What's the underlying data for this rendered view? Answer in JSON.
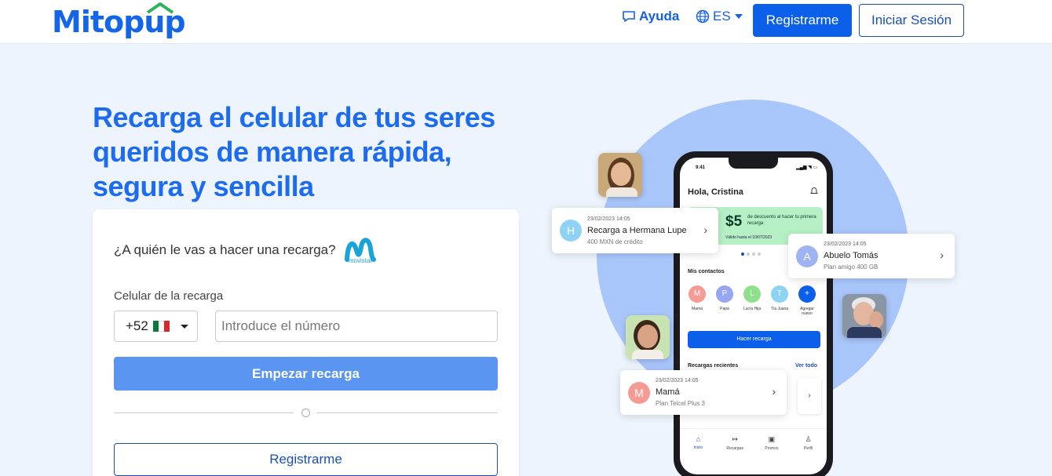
{
  "header": {
    "logo": "Mitopup",
    "help_label": "Ayuda",
    "lang_label": "ES",
    "register_label": "Registrarme",
    "login_label": "Iniciar Sesión"
  },
  "hero": {
    "title": "Recarga el celular de tus seres queridos de manera rápida, segura y sencilla"
  },
  "form": {
    "question": "¿A quién le vas a hacer una recarga?",
    "carrier": "movistar",
    "phone_label": "Celular de la recarga",
    "country_code": "+52",
    "phone_placeholder": "Introduce el número",
    "start_label": "Empezar recarga",
    "register_label": "Registrarme"
  },
  "mockup": {
    "time": "9:41",
    "greeting": "Hola, Cristina",
    "promo_amount": "$5",
    "promo_text": "de descuento al hacer tu primera recarga",
    "promo_sub": "Válido hasta el 10/07/2023",
    "contacts_title": "Mis contactos",
    "contacts": [
      {
        "initial": "M",
        "name": "Mamá",
        "color": "#f59b94"
      },
      {
        "initial": "P",
        "name": "Papá",
        "color": "#96a6f2"
      },
      {
        "initial": "L",
        "name": "Lucía Hija",
        "color": "#8fe08a"
      },
      {
        "initial": "T",
        "name": "Tía Juana",
        "color": "#8dd3f4"
      },
      {
        "initial": "+",
        "name": "Agregar nuevo",
        "color": "#0b5fe9"
      }
    ],
    "recharge_btn": "Hacer recarga",
    "recents_title": "Recargas recientes",
    "see_all": "Ver todo",
    "nav": [
      {
        "label": "Inicio",
        "icon": "home-icon"
      },
      {
        "label": "Recargas",
        "icon": "arrow-icon"
      },
      {
        "label": "Promos",
        "icon": "gift-icon"
      },
      {
        "label": "Perfil",
        "icon": "user-icon"
      }
    ]
  },
  "floats": {
    "lupe": {
      "initial": "H",
      "date": "23/02/2023 14:05",
      "title": "Recarga a Hermana Lupe",
      "sub": "400 MXN de crédito",
      "color": "#8ed3f6"
    },
    "tomas": {
      "initial": "A",
      "date": "23/02/2023 14:05",
      "title": "Abuelo Tomás",
      "sub": "Plan amigo 400 GB",
      "color": "#9fb3f3"
    },
    "mama": {
      "initial": "M",
      "date": "23/02/2023 14:05",
      "title": "Mamá",
      "sub": "Plan Telcel Plus 3",
      "color": "#f59b94"
    }
  },
  "colors": {
    "brand": "#1565e8",
    "primary_button": "#0b5fe9",
    "start_button": "#5b95f2",
    "background": "#eef4fd",
    "circle": "#a9c6fb"
  }
}
